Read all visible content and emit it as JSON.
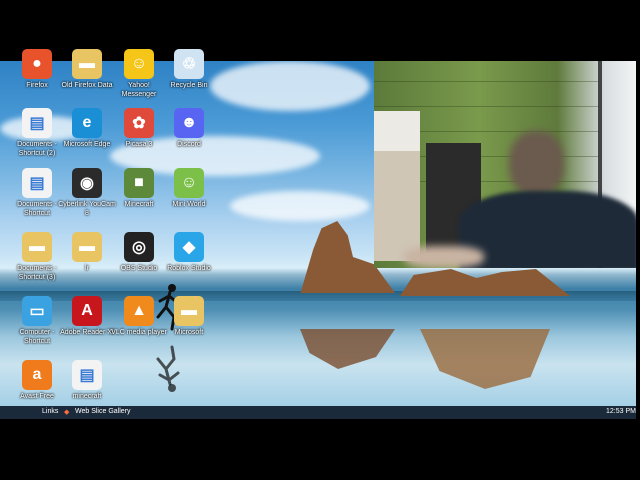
{
  "desktop_icons": [
    {
      "label": "Firefox",
      "icon": "firefox-icon",
      "color": "#e8532b"
    },
    {
      "label": "Old Firefox Data",
      "icon": "folder-icon",
      "color": "#e8c462"
    },
    {
      "label": "Yahoo! Messenger",
      "icon": "yahoo-messenger-icon",
      "color": "#f5c518"
    },
    {
      "label": "Recycle Bin",
      "icon": "recycle-bin-icon",
      "color": "#cfe3f2"
    },
    {
      "label": "Documents - Shortcut (2)",
      "icon": "document-icon",
      "color": "#f3f3f3"
    },
    {
      "label": "Microsoft Edge",
      "icon": "edge-icon",
      "color": "#1a8fd6"
    },
    {
      "label": "Picasa 3",
      "icon": "picasa-icon",
      "color": "#e04a3b"
    },
    {
      "label": "Discord",
      "icon": "discord-icon",
      "color": "#5865f2"
    },
    {
      "label": "Documents - Shortcut",
      "icon": "document-icon",
      "color": "#f3f3f3"
    },
    {
      "label": "Cyberlink YouCam 8",
      "icon": "youcam-icon",
      "color": "#2b2b2b"
    },
    {
      "label": "Minecraft",
      "icon": "minecraft-icon",
      "color": "#5d8a3a"
    },
    {
      "label": "Mini World",
      "icon": "mini-world-icon",
      "color": "#7cc04a"
    },
    {
      "label": "Documents - Shortcut (3)",
      "icon": "folder-icon",
      "color": "#e8c462"
    },
    {
      "label": "lr",
      "icon": "folder-icon",
      "color": "#e8c462"
    },
    {
      "label": "OBS Studio",
      "icon": "obs-icon",
      "color": "#222222"
    },
    {
      "label": "Roblox Studio",
      "icon": "roblox-studio-icon",
      "color": "#2aa5e8"
    },
    {
      "label": "Computer - Shortcut",
      "icon": "computer-icon",
      "color": "#3aa2e0"
    },
    {
      "label": "Adobe Reader XI",
      "icon": "adobe-reader-icon",
      "color": "#c8161d"
    },
    {
      "label": "VLC media player",
      "icon": "vlc-icon",
      "color": "#f08a1c"
    },
    {
      "label": "Microsoft",
      "icon": "folder-icon",
      "color": "#e8c462"
    },
    {
      "label": "Avast Free",
      "icon": "avast-icon",
      "color": "#f07b1c"
    },
    {
      "label": "minecraft",
      "icon": "document-icon",
      "color": "#f3f3f3"
    }
  ],
  "taskbar": {
    "links_label": "Links",
    "web_slice_label": "Web Slice Gallery",
    "clock": "12:53 PM"
  }
}
